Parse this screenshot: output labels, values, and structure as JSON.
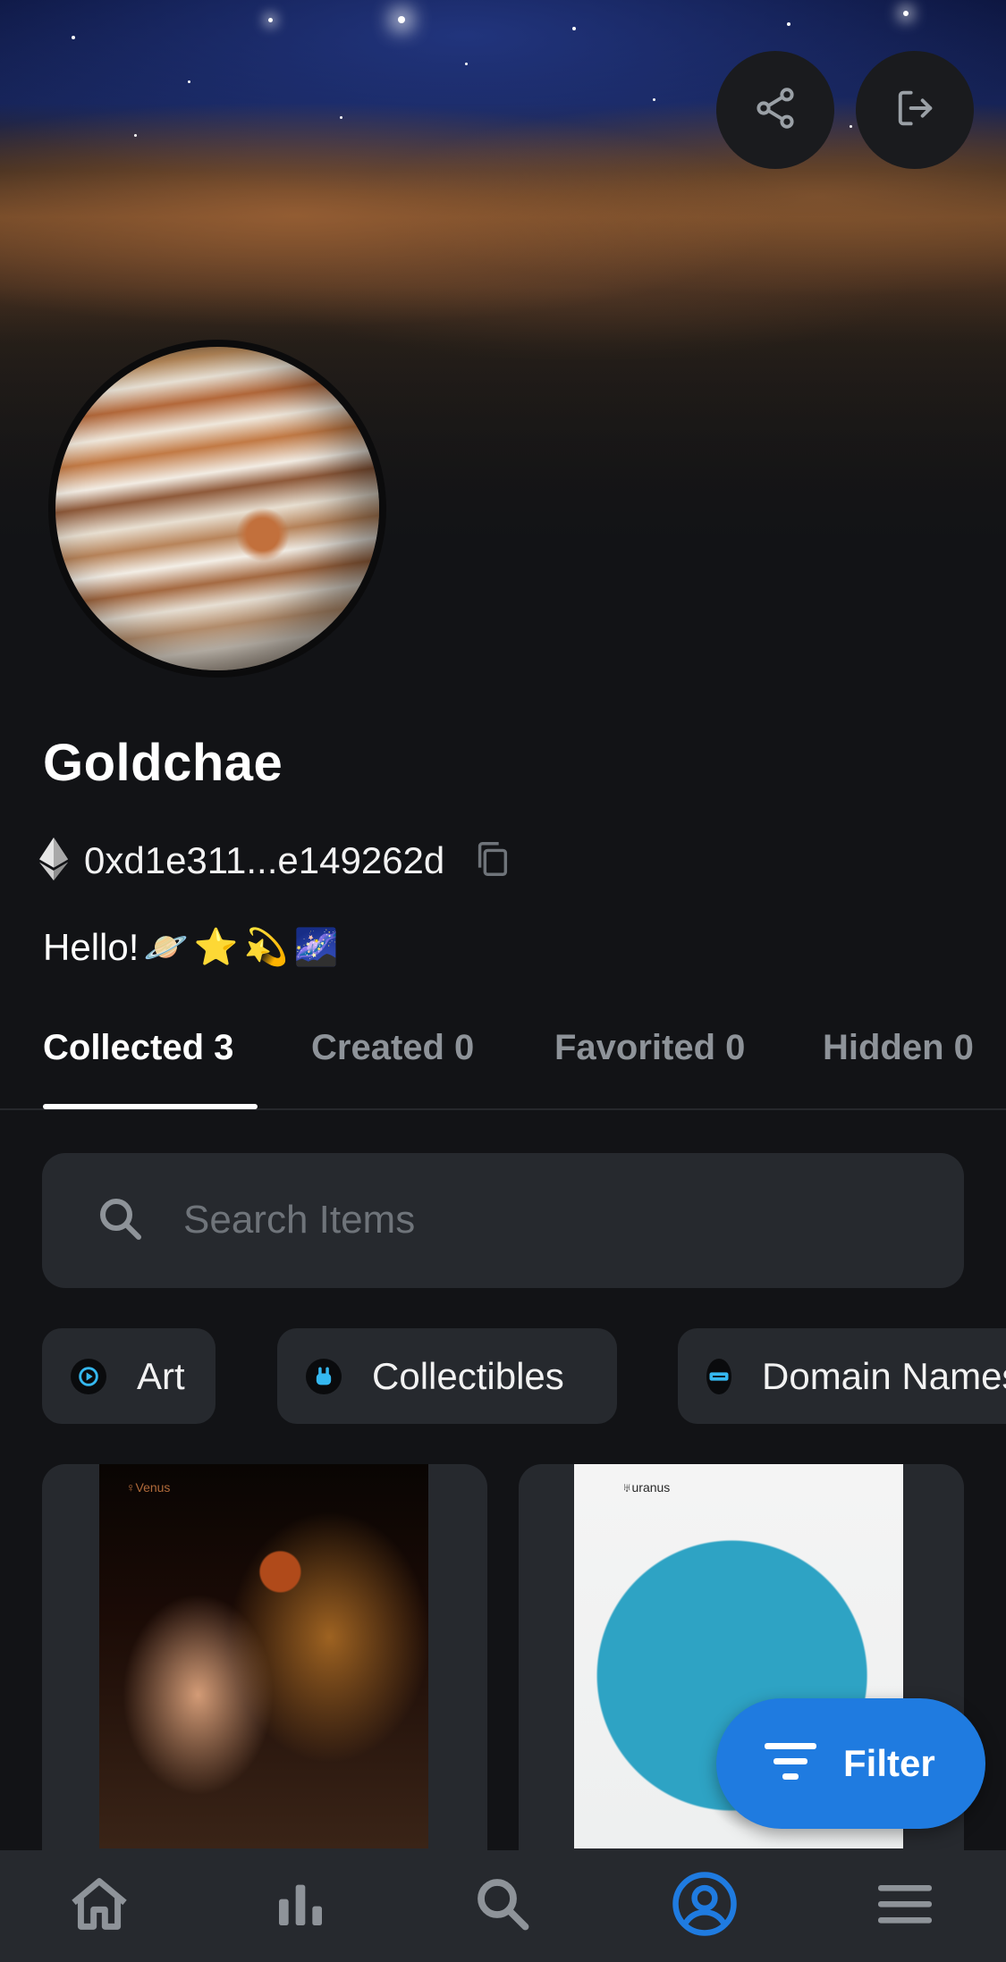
{
  "header": {
    "share_icon": "share-icon",
    "logout_icon": "logout-icon"
  },
  "profile": {
    "name": "Goldchae",
    "address": "0xd1e311...e149262d",
    "chain_icon": "ethereum-icon",
    "copy_icon": "copy-icon",
    "bio_text": "Hello!",
    "bio_emojis": [
      "🪐",
      "⭐",
      "💫",
      "🌌"
    ]
  },
  "tabs": [
    {
      "label": "Collected 3",
      "active": true
    },
    {
      "label": "Created 0",
      "active": false
    },
    {
      "label": "Favorited 0",
      "active": false
    },
    {
      "label": "Hidden 0",
      "active": false
    }
  ],
  "search": {
    "placeholder": "Search Items",
    "value": ""
  },
  "categories": [
    {
      "label": "Art",
      "icon": "art-icon"
    },
    {
      "label": "Collectibles",
      "icon": "collectibles-icon"
    },
    {
      "label": "Domain Names",
      "icon": "domain-names-icon"
    }
  ],
  "items": [
    {
      "tag": "♀Venus"
    },
    {
      "tag": "♅uranus"
    }
  ],
  "filter": {
    "label": "Filter"
  },
  "bottom_nav": [
    {
      "icon": "home-icon",
      "active": false
    },
    {
      "icon": "stats-icon",
      "active": false
    },
    {
      "icon": "search-icon",
      "active": false
    },
    {
      "icon": "profile-icon",
      "active": true
    },
    {
      "icon": "menu-icon",
      "active": false
    }
  ],
  "colors": {
    "background": "#121316",
    "surface": "#26292e",
    "accent": "#1f7be0",
    "muted_text": "#8e9399"
  }
}
